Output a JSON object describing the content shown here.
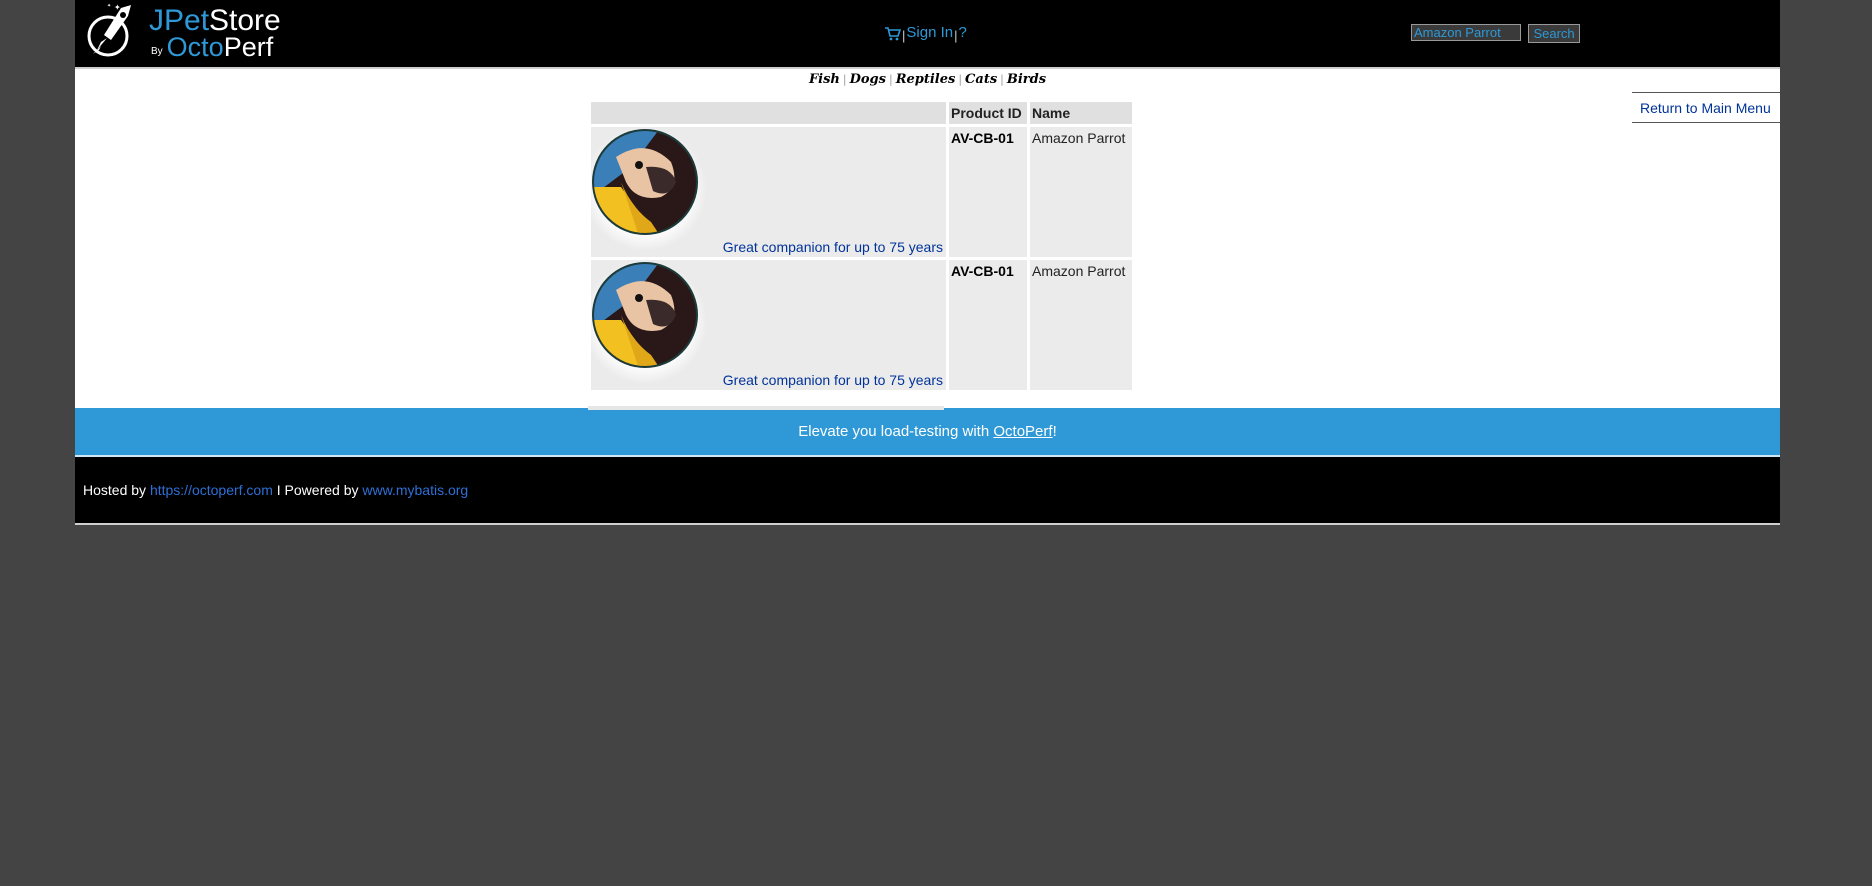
{
  "header": {
    "logo": {
      "name_part1": "JPet",
      "name_part2": "Store",
      "by": "By",
      "brand_part1": "Octo",
      "brand_part2": "Perf"
    },
    "menu": {
      "cart_icon": "cart-icon",
      "separator1": "|",
      "sign_in": "Sign In",
      "separator2": "|",
      "help": "?"
    },
    "search": {
      "value": "Amazon Parrot",
      "button_label": "Search"
    }
  },
  "quicklinks": {
    "items": [
      "Fish",
      "Dogs",
      "Reptiles",
      "Cats",
      "Birds"
    ],
    "separator": "|"
  },
  "sidebar": {
    "return_label": "Return to Main Menu"
  },
  "table": {
    "headers": [
      "",
      "Product ID",
      "Name"
    ],
    "rows": [
      {
        "image_icon": "parrot-image",
        "description": "Great companion for up to 75 years",
        "product_id": "AV-CB-01",
        "name": "Amazon Parrot"
      },
      {
        "image_icon": "parrot-image",
        "description": "Great companion for up to 75 years",
        "product_id": "AV-CB-01",
        "name": "Amazon Parrot"
      }
    ]
  },
  "banner": {
    "text_before": "Elevate you load-testing with ",
    "link": "OctoPerf",
    "text_after": "!"
  },
  "footer": {
    "hosted_by": "Hosted by ",
    "host_link": "https://octoperf.com",
    "powered_by": " I Powered by ",
    "powered_link": "www.mybatis.org"
  },
  "colors": {
    "background": "#444444",
    "accent": "#2e99d6",
    "link": "#003399",
    "header_bg": "#000000"
  }
}
